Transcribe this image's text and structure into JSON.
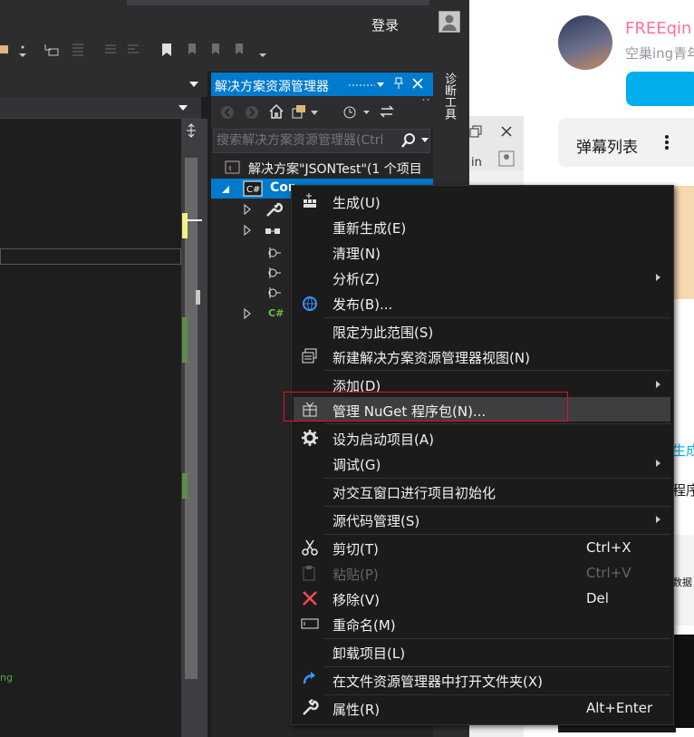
{
  "titlebar": {
    "login": "登录"
  },
  "editor": {
    "code_snippet": "ng"
  },
  "solution_explorer": {
    "title": "解决方案资源管理器",
    "search_placeholder": "搜索解决方案资源管理器(Ctrl",
    "solution_label": "解决方案\"JSONTest\"(1 个项目",
    "project_label": "Cor",
    "side_tab_label": "诊断工具"
  },
  "web": {
    "user_name": "FREEqin",
    "user_sub": "空巢ing青年",
    "danmu_label": "弹幕列表",
    "snippets": [
      "生成",
      "程序",
      "数据"
    ]
  },
  "context_menu": {
    "items": [
      {
        "label": "生成(U)",
        "icon": "build-icon"
      },
      {
        "label": "重新生成(E)"
      },
      {
        "label": "清理(N)"
      },
      {
        "label": "分析(Z)",
        "submenu": true
      },
      {
        "label": "发布(B)...",
        "icon": "publish-globe-icon"
      },
      {
        "label": "限定为此范围(S)"
      },
      {
        "label": "新建解决方案资源管理器视图(N)",
        "icon": "new-view-icon"
      },
      {
        "label": "添加(D)",
        "submenu": true
      },
      {
        "label": "管理 NuGet 程序包(N)...",
        "icon": "nuget-package-icon",
        "highlighted": true
      },
      {
        "label": "设为启动项目(A)",
        "icon": "gear-icon"
      },
      {
        "label": "调试(G)",
        "submenu": true
      },
      {
        "label": "对交互窗口进行项目初始化"
      },
      {
        "label": "源代码管理(S)",
        "submenu": true
      },
      {
        "label": "剪切(T)",
        "shortcut": "Ctrl+X",
        "icon": "scissors-icon"
      },
      {
        "label": "粘贴(P)",
        "shortcut": "Ctrl+V",
        "icon": "paste-icon",
        "disabled": true
      },
      {
        "label": "移除(V)",
        "shortcut": "Del",
        "icon": "remove-x-icon"
      },
      {
        "label": "重命名(M)",
        "icon": "rename-icon"
      },
      {
        "label": "卸载项目(L)"
      },
      {
        "label": "在文件资源管理器中打开文件夹(X)",
        "icon": "refresh-arrow-icon"
      },
      {
        "label": "属性(R)",
        "shortcut": "Alt+Enter",
        "icon": "wrench-icon"
      }
    ]
  },
  "colors": {
    "accent": "#007acc",
    "menu_bg": "#1b1b1c",
    "highlight_outline": "#e81123",
    "bili_pink": "#fb7299",
    "bili_blue": "#00aeec"
  }
}
